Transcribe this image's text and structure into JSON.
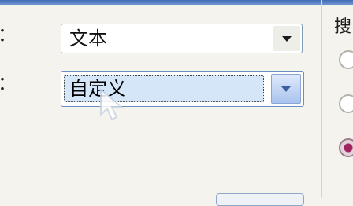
{
  "left_labels": [
    "：",
    "："
  ],
  "dropdown1": {
    "value": "文本"
  },
  "dropdown2": {
    "value": "自定义"
  },
  "right_group": {
    "title": "搜"
  },
  "radios": [
    {
      "checked": false
    },
    {
      "checked": false
    },
    {
      "checked": true
    }
  ]
}
